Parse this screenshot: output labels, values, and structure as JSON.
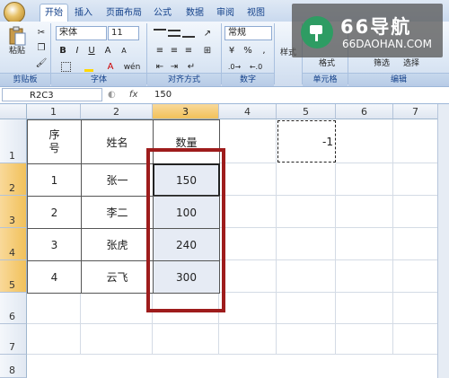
{
  "ribbon": {
    "tabs": [
      "开始",
      "插入",
      "页面布局",
      "公式",
      "数据",
      "审阅",
      "视图"
    ],
    "active_tab": "开始",
    "clipboard": {
      "paste_label": "粘贴",
      "group_label": "剪贴板"
    },
    "font": {
      "name": "宋体",
      "size": "11",
      "group_label": "字体"
    },
    "alignment": {
      "group_label": "对齐方式"
    },
    "number": {
      "format": "常规",
      "group_label": "数字"
    },
    "styles": {
      "label": "样式"
    },
    "cells": {
      "format_label": "格式",
      "group_label": "单元格"
    },
    "editing": {
      "sort_label": "筛选",
      "find_label": "选择",
      "group_label": "编辑"
    }
  },
  "watermark": {
    "title": "66导航",
    "subtitle": "66DAOHAN.COM"
  },
  "formula_bar": {
    "name_box": "R2C3",
    "fx": "fx",
    "value": "150"
  },
  "sheet": {
    "columns": [
      "1",
      "2",
      "3",
      "4",
      "5",
      "6",
      "7"
    ],
    "rows": [
      "1",
      "2",
      "3",
      "4",
      "5",
      "6",
      "7",
      "8"
    ],
    "header_row": {
      "seq_line1": "序",
      "seq_line2": "号",
      "name": "姓名",
      "qty": "数量"
    },
    "data": [
      {
        "seq": "1",
        "name": "张一",
        "qty": "150"
      },
      {
        "seq": "2",
        "name": "李二",
        "qty": "100"
      },
      {
        "seq": "3",
        "name": "张虎",
        "qty": "240"
      },
      {
        "seq": "4",
        "name": "云飞",
        "qty": "300"
      }
    ],
    "copied_cell_value": "-1",
    "selected_column": "3",
    "selected_rows": [
      "2",
      "3",
      "4",
      "5"
    ]
  },
  "colors": {
    "highlight_box": "#9e1c1c",
    "selection": "#e6ebf4",
    "header_selected": "#f1c15a"
  }
}
